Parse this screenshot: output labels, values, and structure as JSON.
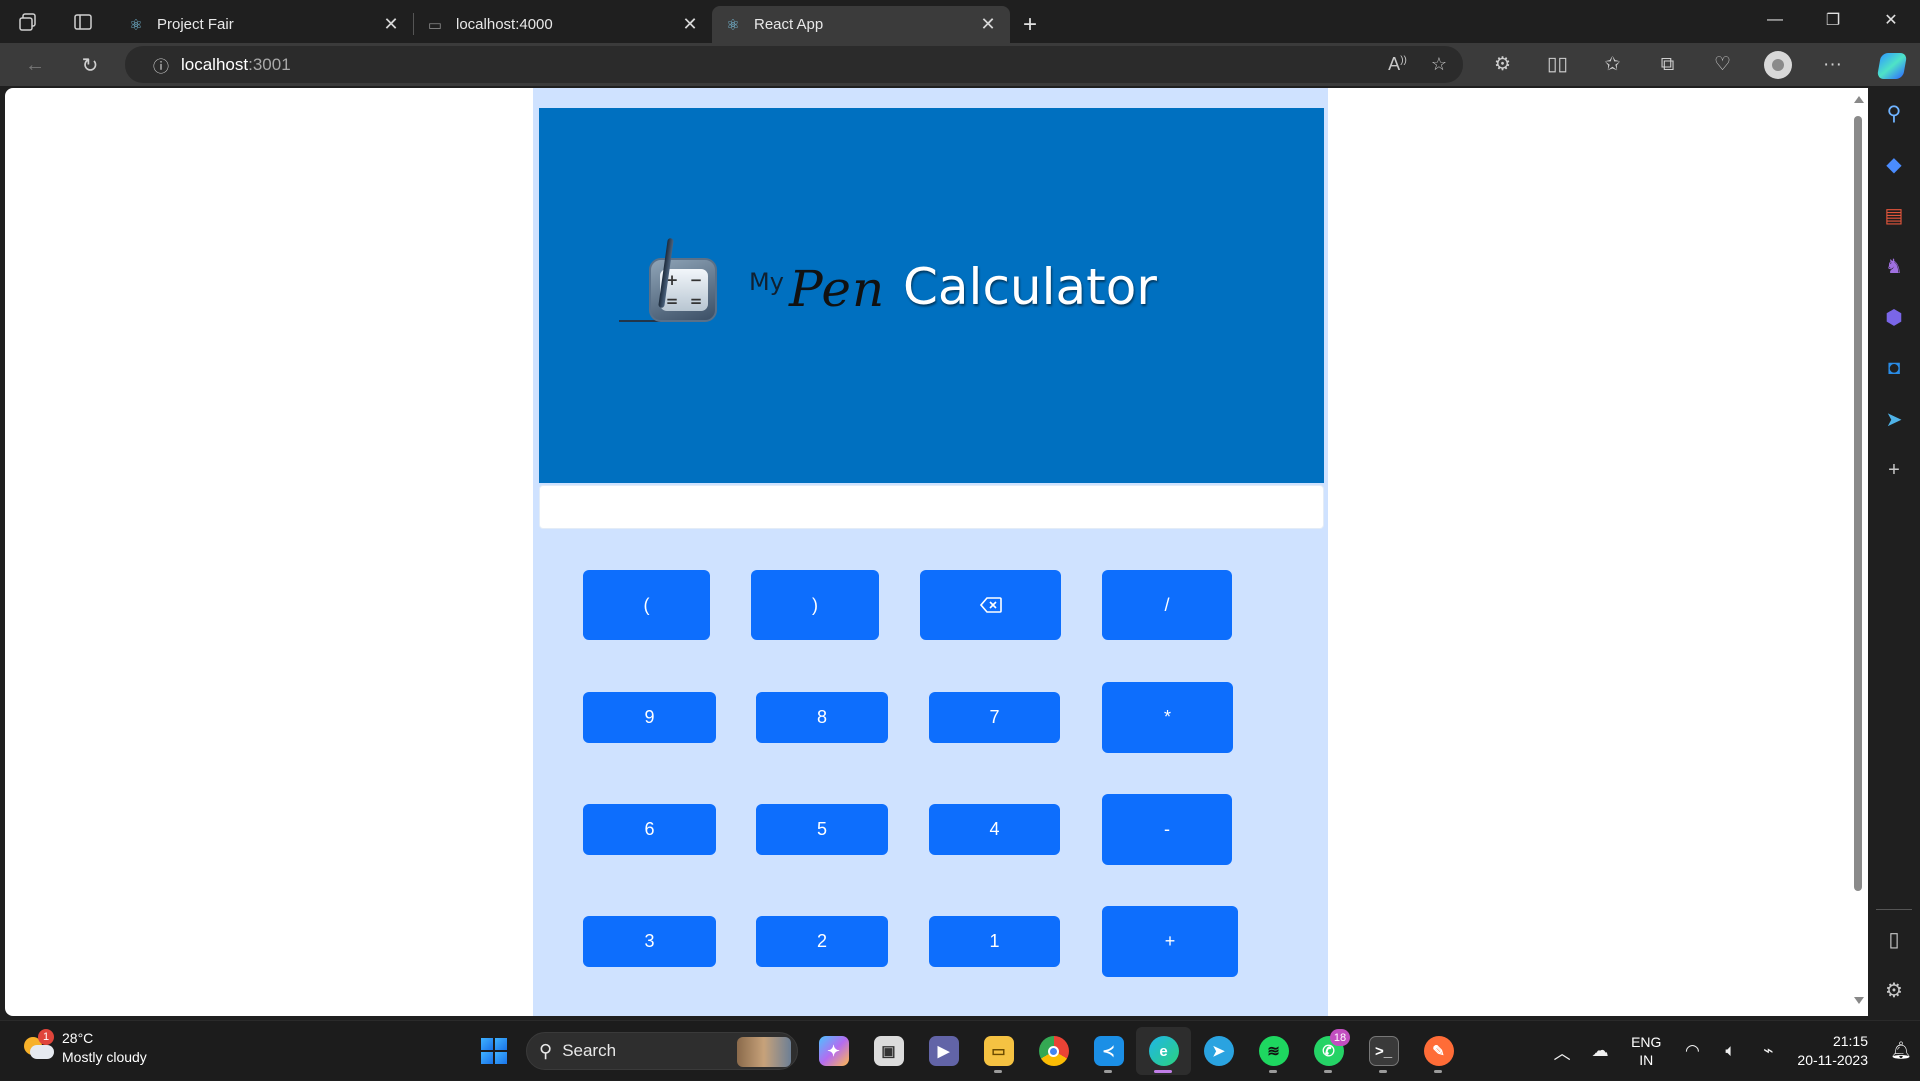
{
  "browser": {
    "tabs": [
      {
        "title": "Project Fair",
        "favicon": "react-icon",
        "active": false
      },
      {
        "title": "localhost:4000",
        "favicon": "page-icon",
        "active": false
      },
      {
        "title": "React App",
        "favicon": "react-icon",
        "active": true
      }
    ],
    "url_host": "localhost",
    "url_port": ":3001"
  },
  "app": {
    "logo": {
      "my": "My",
      "pen": "Pen",
      "calc": "Calculator"
    },
    "display_value": "",
    "buttons": [
      {
        "label": "(",
        "key": "open-paren"
      },
      {
        "label": ")",
        "key": "close-paren"
      },
      {
        "label": "",
        "key": "backspace",
        "icon": "backspace-icon"
      },
      {
        "label": "/",
        "key": "divide"
      },
      {
        "label": "9",
        "key": "9"
      },
      {
        "label": "8",
        "key": "8"
      },
      {
        "label": "7",
        "key": "7"
      },
      {
        "label": "*",
        "key": "multiply"
      },
      {
        "label": "6",
        "key": "6"
      },
      {
        "label": "5",
        "key": "5"
      },
      {
        "label": "4",
        "key": "4"
      },
      {
        "label": "-",
        "key": "minus"
      },
      {
        "label": "3",
        "key": "3"
      },
      {
        "label": "2",
        "key": "2"
      },
      {
        "label": "1",
        "key": "1"
      },
      {
        "label": "+",
        "key": "plus"
      }
    ],
    "colors": {
      "hero": "#0070c0",
      "button": "#0d6efd",
      "panel": "#cfe2ff"
    }
  },
  "taskbar": {
    "weather": {
      "temp": "28°C",
      "desc": "Mostly cloudy",
      "badge": "1"
    },
    "search_label": "Search",
    "apps": [
      "copilot-pre-icon",
      "task-view-icon",
      "teams-icon",
      "file-explorer-icon",
      "chrome-icon",
      "vscode-icon",
      "edge-icon",
      "telegram-icon",
      "spotify-icon",
      "whatsapp-icon",
      "terminal-icon",
      "postman-icon"
    ],
    "whatsapp_badge": "18",
    "lang_line1": "ENG",
    "lang_line2": "IN",
    "time": "21:15",
    "date": "20-11-2023"
  }
}
